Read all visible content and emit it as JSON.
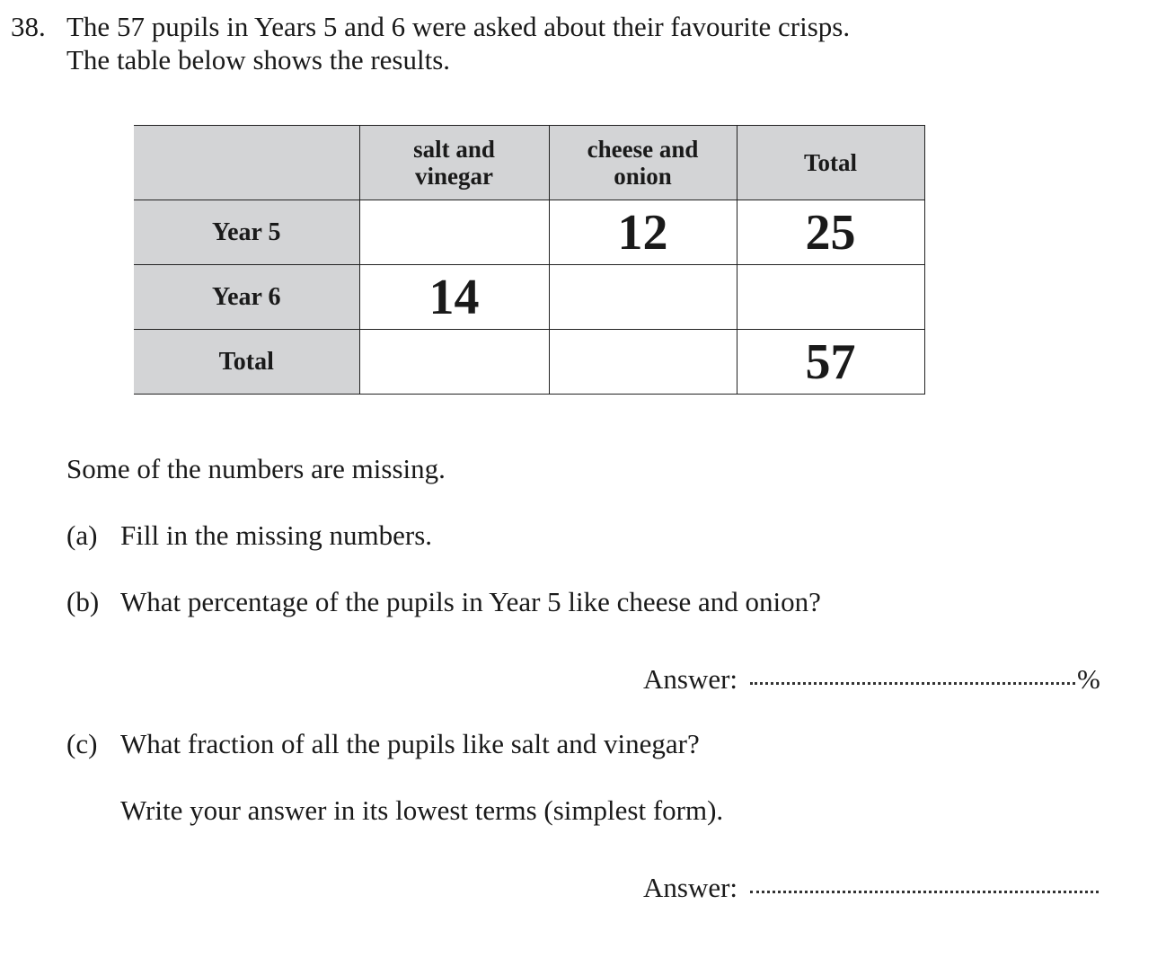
{
  "question": {
    "number": "38.",
    "line1": "The 57 pupils in Years 5 and 6 were asked about their favourite crisps.",
    "line2": "The table below shows the results."
  },
  "table": {
    "columns": [
      "",
      "salt and vinegar",
      "cheese and onion",
      "Total"
    ],
    "column_lines": [
      [
        "",
        ""
      ],
      [
        "salt and",
        "vinegar"
      ],
      [
        "cheese and",
        "onion"
      ],
      [
        "Total",
        ""
      ]
    ],
    "rows": [
      {
        "label": "Year 5",
        "cells": [
          "",
          "12",
          "25"
        ]
      },
      {
        "label": "Year 6",
        "cells": [
          "14",
          "",
          ""
        ]
      },
      {
        "label": "Total",
        "cells": [
          "",
          "",
          "57"
        ]
      }
    ]
  },
  "body": {
    "missing_note": "Some of the numbers are missing.",
    "parts": [
      {
        "label": "(a)",
        "text": "Fill in the missing numbers."
      },
      {
        "label": "(b)",
        "text": "What percentage of the pupils in Year 5 like cheese and onion?"
      },
      {
        "label": "(c)",
        "text": "What fraction of all the pupils like salt and vinegar?"
      }
    ],
    "part_c_note": "Write your answer in its lowest terms (simplest form)."
  },
  "answers": {
    "b": {
      "label": "Answer:",
      "value": "",
      "unit": "%"
    },
    "c": {
      "label": "Answer:",
      "value": ""
    }
  }
}
